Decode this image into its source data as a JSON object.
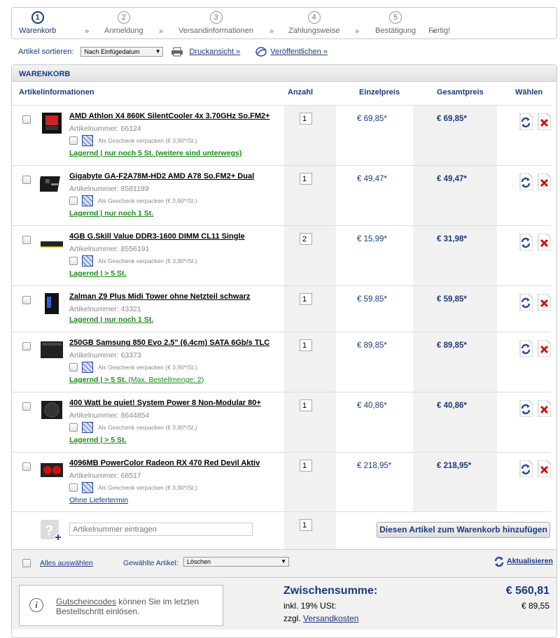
{
  "steps": [
    {
      "num": "1",
      "label": "Warenkorb"
    },
    {
      "num": "2",
      "label": "Anmeldung"
    },
    {
      "num": "3",
      "label": "Versandinformationen"
    },
    {
      "num": "4",
      "label": "Zahlungsweise"
    },
    {
      "num": "5",
      "label": "Bestätigung"
    },
    {
      "num": "",
      "label": "Fertig!"
    }
  ],
  "step_separator": "»",
  "toolbar": {
    "sort_label": "Artikel sortieren:",
    "sort_value": "Nach Einfügedatum",
    "print_link": "Druckansicht »",
    "publish_link": "Veröffentlichen »"
  },
  "cart": {
    "title": "WARENKORB",
    "headers": {
      "info": "Artikelinformationen",
      "qty": "Anzahl",
      "unit": "Einzelpreis",
      "total": "Gesamtpreis",
      "choose": "Wählen"
    },
    "gift_label": "Als Geschenk verpacken (€ 3,90*/St.)",
    "items": [
      {
        "name": "AMD Athlon X4 860K SilentCooler 4x 3.70GHz So.FM2+",
        "artnr": "Artikelnummer: 66124",
        "stock": "Lagernd | nur noch 5 St. (weitere sind unterwegs)",
        "stock_extra": "",
        "qty": "1",
        "unit_price": "€ 69,85*",
        "total_price": "€ 69,85*"
      },
      {
        "name": "Gigabyte GA-F2A78M-HD2 AMD A78 So.FM2+ Dual",
        "artnr": "Artikelnummer: 8581189",
        "stock": "Lagernd | nur noch 1 St.",
        "stock_extra": "",
        "qty": "1",
        "unit_price": "€ 49,47*",
        "total_price": "€ 49,47*"
      },
      {
        "name": "4GB G.Skill Value DDR3-1600 DIMM CL11 Single",
        "artnr": "Artikelnummer: 8556191",
        "stock": "Lagernd | > 5 St.",
        "stock_extra": "",
        "qty": "2",
        "unit_price": "€ 15,99*",
        "total_price": "€ 31,98*"
      },
      {
        "name": "Zalman Z9 Plus Midi Tower ohne Netzteil schwarz",
        "artnr": "Artikelnummer: 43321",
        "stock": "Lagernd | nur noch 1 St.",
        "stock_extra": "",
        "qty": "1",
        "unit_price": "€ 59,85*",
        "total_price": "€ 59,85*"
      },
      {
        "name": "250GB Samsung 850 Evo 2.5\" (6.4cm) SATA 6Gb/s TLC",
        "artnr": "Artikelnummer: 63373",
        "stock": "Lagernd | > 5 St.",
        "stock_extra": " (Max. Bestellmenge: 2)",
        "qty": "1",
        "unit_price": "€ 89,85*",
        "total_price": "€ 89,85*"
      },
      {
        "name": "400 Watt be quiet! System Power 8 Non-Modular 80+",
        "artnr": "Artikelnummer: 8644854",
        "stock": "Lagernd | > 5 St.",
        "stock_extra": "",
        "qty": "1",
        "unit_price": "€ 40,86*",
        "total_price": "€ 40,86*"
      },
      {
        "name": "4096MB PowerColor Radeon RX 470 Red Devil Aktiv",
        "artnr": "Artikelnummer: 68517",
        "stock": "Ohne Liefertermin",
        "stock_extra": "",
        "qty": "1",
        "unit_price": "€ 218,95*",
        "total_price": "€ 218,95*"
      }
    ],
    "add_row": {
      "placeholder": "Artikelnummer eintragen",
      "qty": "1",
      "button": "Diesen Artikel zum Warenkorb hinzufügen"
    },
    "footer": {
      "select_all": "Alles auswählen",
      "selected_label": "Gewählte Artikel:",
      "selected_action": "Löschen",
      "refresh": "Aktualisieren"
    },
    "summary": {
      "coupon_link": "Gutscheincodes",
      "coupon_text": " können Sie im letzten Bestellschritt einlösen.",
      "subtotal_label": "Zwischensumme:",
      "subtotal_value": "€ 560,81",
      "vat_label": "inkl. 19% USt:",
      "vat_value": "€ 89,55",
      "shipping_prefix": "zzgl. ",
      "shipping_link": "Versandkosten"
    }
  },
  "colors": {
    "accent": "#1a3a7a",
    "stock_green": "#1c8a1c",
    "delete_red": "#d01010"
  }
}
